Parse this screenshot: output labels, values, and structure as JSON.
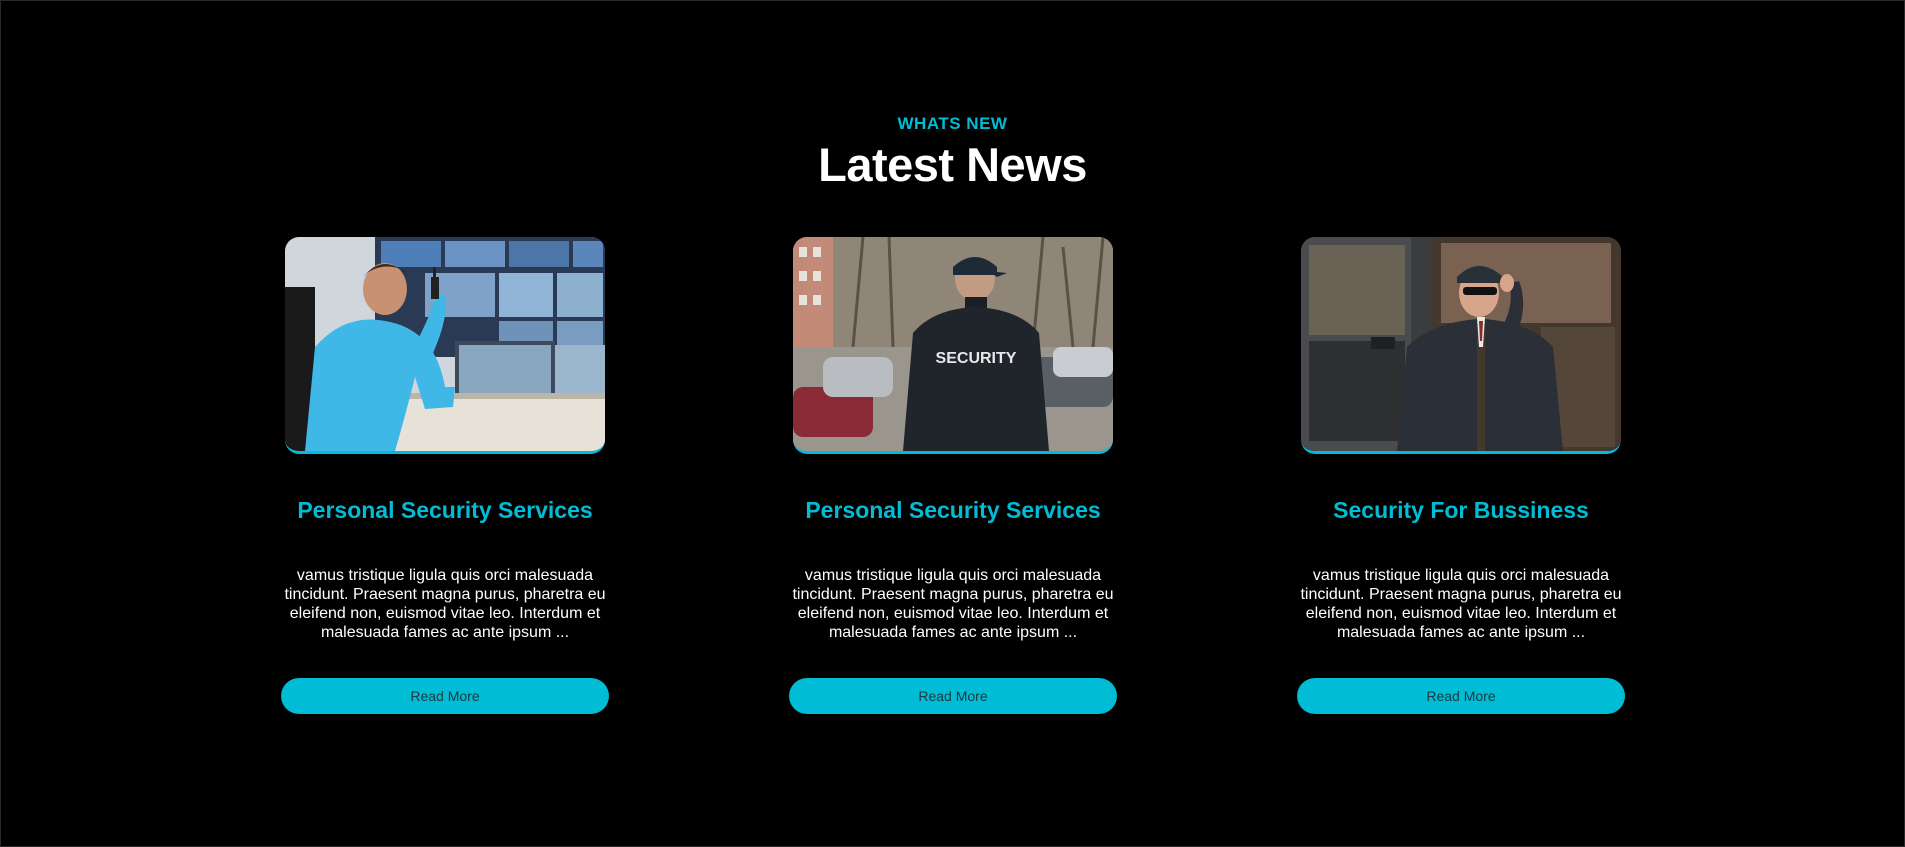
{
  "section": {
    "eyebrow": "WHATS NEW",
    "title": "Latest News"
  },
  "accent_color": "#00bcd4",
  "background_color": "#000000",
  "cards": [
    {
      "image": "security-operator-monitoring-photo",
      "title": "Personal Security Services",
      "text": "vamus tristique ligula quis orci malesuada tincidunt. Praesent magna purus, pharetra eu eleifend non, euismod vitae leo. Interdum et malesuada fames ac ante ipsum ...",
      "button_label": "Read More"
    },
    {
      "image": "security-guard-back-photo",
      "title": "Personal Security Services",
      "text": "vamus tristique ligula quis orci malesuada tincidunt. Praesent magna purus, pharetra eu eleifend non, euismod vitae leo. Interdum et malesuada fames ac ante ipsum ...",
      "button_label": "Read More"
    },
    {
      "image": "bodyguard-earpiece-photo",
      "title": "Security For Bussiness",
      "text": "vamus tristique ligula quis orci malesuada tincidunt. Praesent magna purus, pharetra eu eleifend non, euismod vitae leo. Interdum et malesuada fames ac ante ipsum ...",
      "button_label": "Read More"
    }
  ]
}
